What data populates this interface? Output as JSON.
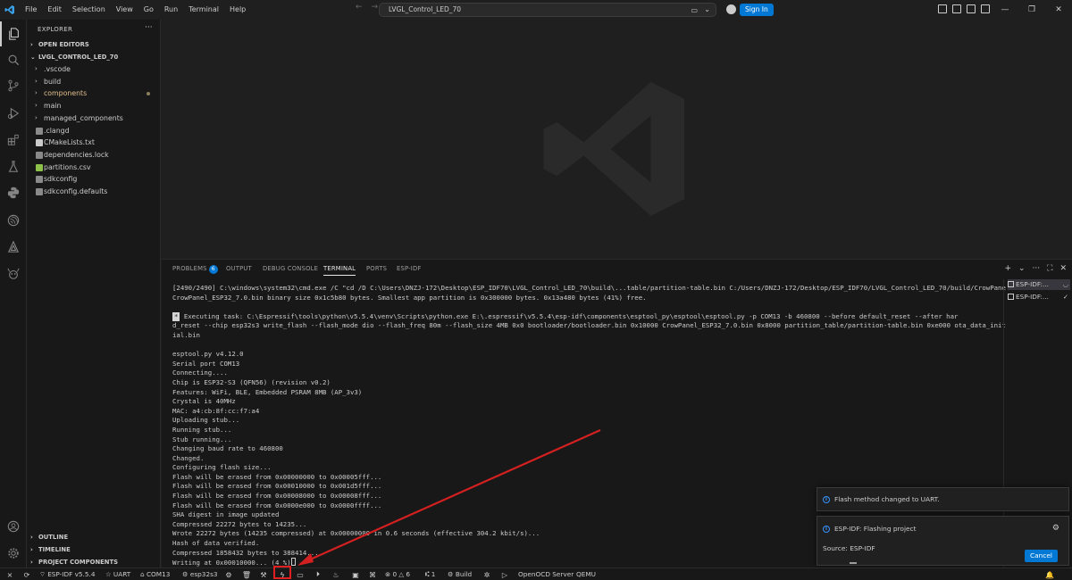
{
  "titlebar": {
    "menu": [
      "File",
      "Edit",
      "Selection",
      "View",
      "Go",
      "Run",
      "Terminal",
      "Help"
    ],
    "search_text": "LVGL_Control_LED_70",
    "sign_in": "Sign In"
  },
  "sidebar": {
    "title": "EXPLORER",
    "open_editors": "OPEN EDITORS",
    "project": "LVGL_CONTROL_LED_70",
    "items": [
      {
        "label": ".vscode",
        "type": "folder"
      },
      {
        "label": "build",
        "type": "folder"
      },
      {
        "label": "components",
        "type": "folder",
        "modified": true
      },
      {
        "label": "main",
        "type": "folder"
      },
      {
        "label": "managed_components",
        "type": "folder"
      },
      {
        "label": ".clangd",
        "type": "file"
      },
      {
        "label": "CMakeLists.txt",
        "type": "file"
      },
      {
        "label": "dependencies.lock",
        "type": "file"
      },
      {
        "label": "partitions.csv",
        "type": "file"
      },
      {
        "label": "sdkconfig",
        "type": "file"
      },
      {
        "label": "sdkconfig.defaults",
        "type": "file"
      }
    ],
    "outline": "OUTLINE",
    "timeline": "TIMELINE",
    "project_components": "PROJECT COMPONENTS"
  },
  "panel": {
    "tabs": [
      "PROBLEMS",
      "OUTPUT",
      "DEBUG CONSOLE",
      "TERMINAL",
      "PORTS",
      "ESP-IDF"
    ],
    "problems_count": "6",
    "active_tab": "TERMINAL",
    "terminal_lines": [
      "[2490/2490] C:\\windows\\system32\\cmd.exe /C \"cd /D C:\\Users\\DNZJ-172\\Desktop\\ESP_IDF70\\LVGL_Control_LED_70\\build\\...table/partition-table.bin C:/Users/DNZJ-172/Desktop/ESP_IDF70/LVGL_Control_LED_70/build/CrowPane",
      "CrowPanel_ESP32_7.0.bin binary size 0x1c5b80 bytes. Smallest app partition is 0x300000 bytes. 0x13a480 bytes (41%) free.",
      "",
      "@@EXEC Executing task: C:\\Espressif\\tools\\python\\v5.5.4\\venv\\Scripts\\python.exe E:\\.espressif\\v5.5.4\\esp-idf\\components\\esptool_py\\esptool\\esptool.py -p COM13 -b 460800 --before default_reset --after har",
      "d_reset --chip esp32s3 write_flash --flash_mode dio --flash_freq 80m --flash_size 4MB 0x0 bootloader/bootloader.bin 0x10000 CrowPanel_ESP32_7.0.bin 0x8000 partition_table/partition-table.bin 0xe000 ota_data_init",
      "ial.bin",
      "",
      "esptool.py v4.12.0",
      "Serial port COM13",
      "Connecting....",
      "Chip is ESP32-S3 (QFN56) (revision v0.2)",
      "Features: WiFi, BLE, Embedded PSRAM 8MB (AP_3v3)",
      "Crystal is 40MHz",
      "MAC: a4:cb:8f:cc:f7:a4",
      "Uploading stub...",
      "Running stub...",
      "Stub running...",
      "Changing baud rate to 460800",
      "Changed.",
      "Configuring flash size...",
      "Flash will be erased from 0x00000000 to 0x00005fff...",
      "Flash will be erased from 0x00010000 to 0x001d5fff...",
      "Flash will be erased from 0x00008000 to 0x00008fff...",
      "Flash will be erased from 0x0000e000 to 0x0000ffff...",
      "SHA digest in image updated",
      "Compressed 22272 bytes to 14235...",
      "Wrote 22272 bytes (14235 compressed) at 0x00000000 in 0.6 seconds (effective 304.2 kbit/s)...",
      "Hash of data verified.",
      "Compressed 1858432 bytes to 388414...",
      "Writing at 0x00010000... (4 %)"
    ],
    "terminal_list": [
      "ESP-IDF:...",
      "ESP-IDF:..."
    ]
  },
  "notifications": {
    "flash_method": "Flash method changed to UART.",
    "flashing_title": "ESP-IDF: Flashing project",
    "source": "Source: ESP-IDF",
    "cancel": "Cancel"
  },
  "statusbar": {
    "idf_version": "ESP-IDF v5.5.4",
    "uart": "UART",
    "port": "COM13",
    "target": "esp32s3",
    "errors": "0",
    "warnings": "6",
    "ports_count": "1",
    "build": "Build",
    "openocd": "OpenOCD Server",
    "qemu": "QEMU"
  },
  "colors": {
    "accent": "#0078d4",
    "highlight": "#e02020",
    "annotation_arrow": "#d42020"
  }
}
